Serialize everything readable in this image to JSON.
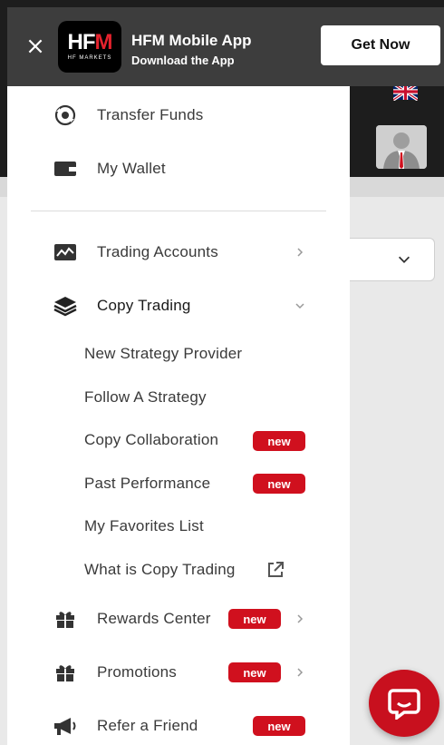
{
  "banner": {
    "logo_main": "HFM",
    "logo_sub": "HF MARKETS",
    "title": "HFM Mobile App",
    "subtitle": "Download the App",
    "cta_label": "Get Now"
  },
  "menu": {
    "top_items": [
      {
        "label": "Transfer Funds",
        "icon": "transfer-icon"
      },
      {
        "label": "My Wallet",
        "icon": "wallet-icon"
      }
    ],
    "trading_accounts": {
      "label": "Trading Accounts",
      "icon": "chart-icon"
    },
    "copy_trading": {
      "label": "Copy Trading",
      "icon": "layers-icon",
      "subitems": [
        {
          "label": "New Strategy Provider"
        },
        {
          "label": "Follow A Strategy"
        },
        {
          "label": "Copy Collaboration",
          "badge": "new"
        },
        {
          "label": "Past Performance",
          "badge": "new"
        },
        {
          "label": "My Favorites List"
        },
        {
          "label": "What is Copy Trading",
          "icon": "external-link-icon"
        }
      ]
    },
    "rewards_center": {
      "label": "Rewards Center",
      "badge": "new",
      "icon": "gift-icon"
    },
    "promotions": {
      "label": "Promotions",
      "badge": "new",
      "icon": "gift-icon"
    },
    "refer_friend": {
      "label": "Refer a Friend",
      "badge": "new",
      "icon": "megaphone-icon"
    }
  },
  "colors": {
    "brand_red": "#d0101e",
    "banner_bg": "#3d3d3d",
    "header_bg": "#1d1d1d"
  }
}
